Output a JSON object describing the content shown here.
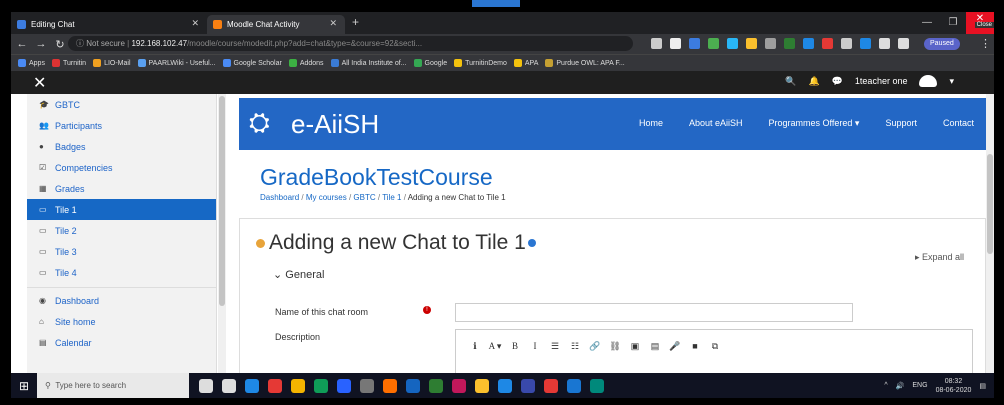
{
  "browser": {
    "tabs": [
      {
        "label": "Editing Chat",
        "color": "#3c7ce0"
      },
      {
        "label": "Moodle Chat Activity",
        "color": "#f98012"
      }
    ],
    "new_tab": "+",
    "close_tooltip": "Close",
    "url": {
      "security": "Not secure",
      "host": "192.168.102.47",
      "path": "/moodle/course/modedit.php?add=chat&type=&course=92&secti..."
    },
    "profile_badge": "Paused"
  },
  "bookmarks": [
    {
      "label": "Apps",
      "color": "#4a8af4"
    },
    {
      "label": "Turnitin",
      "color": "#d33"
    },
    {
      "label": "LIO-Mail",
      "color": "#f0a020"
    },
    {
      "label": "PAARLWiki - Useful...",
      "color": "#5aa0f0"
    },
    {
      "label": "Google Scholar",
      "color": "#4a8af4"
    },
    {
      "label": "Addons",
      "color": "#3cb043"
    },
    {
      "label": "All India Institute of...",
      "color": "#3a7bd5"
    },
    {
      "label": "Google",
      "color": "#34a853"
    },
    {
      "label": "TurnitinDemo",
      "color": "#f4c20d"
    },
    {
      "label": "APA",
      "color": "#f4c20d"
    },
    {
      "label": "Purdue OWL: APA F...",
      "color": "#c5a032"
    }
  ],
  "moodle_bar": {
    "user_name": "1teacher one"
  },
  "sidebar": {
    "items": [
      {
        "label": "GBTC",
        "icon": "graduation-cap-icon"
      },
      {
        "label": "Participants",
        "icon": "users-icon"
      },
      {
        "label": "Badges",
        "icon": "badge-icon"
      },
      {
        "label": "Competencies",
        "icon": "check-square-icon"
      },
      {
        "label": "Grades",
        "icon": "table-icon"
      },
      {
        "label": "Tile 1",
        "icon": "folder-icon",
        "active": true
      },
      {
        "label": "Tile 2",
        "icon": "folder-icon"
      },
      {
        "label": "Tile 3",
        "icon": "folder-icon"
      },
      {
        "label": "Tile 4",
        "icon": "folder-icon"
      },
      {
        "label": "Dashboard",
        "icon": "dashboard-icon"
      },
      {
        "label": "Site home",
        "icon": "home-icon"
      },
      {
        "label": "Calendar",
        "icon": "calendar-icon"
      }
    ]
  },
  "brand": {
    "name": "e-AiiSH",
    "nav": [
      "Home",
      "About eAiiSH",
      "Programmes Offered ▾",
      "Support",
      "Contact"
    ]
  },
  "course_title": "GradeBookTestCourse",
  "breadcrumb": [
    "Dashboard",
    "My courses",
    "GBTC",
    "Tile 1",
    "Adding a new Chat to Tile 1"
  ],
  "page_heading": "Adding a new Chat to Tile 1",
  "expand_all": "▸ Expand all",
  "section_general": "General",
  "form": {
    "name_label": "Name of this chat room",
    "name_value": "",
    "description_label": "Description"
  },
  "editor_toolbar": [
    "ℹ",
    "A ▾",
    "B",
    "I",
    "☰",
    "☷",
    "🔗",
    "⛓",
    "▣",
    "▤",
    "🎤",
    "■",
    "⧉"
  ],
  "taskbar": {
    "search_placeholder": "Type here to search",
    "language": "ENG",
    "time": "08:32",
    "date": "08-06-2020",
    "app_colors": [
      "#ddd",
      "#ddd",
      "#1e88e5",
      "#e53935",
      "#f4b400",
      "#0f9d58",
      "#2962ff",
      "#777",
      "#ff6f00",
      "#1565c0",
      "#2e7d32",
      "#c2185b",
      "#fbc02d",
      "#1e88e5",
      "#3949ab",
      "#e53935",
      "#1976d2",
      "#00897b"
    ]
  }
}
